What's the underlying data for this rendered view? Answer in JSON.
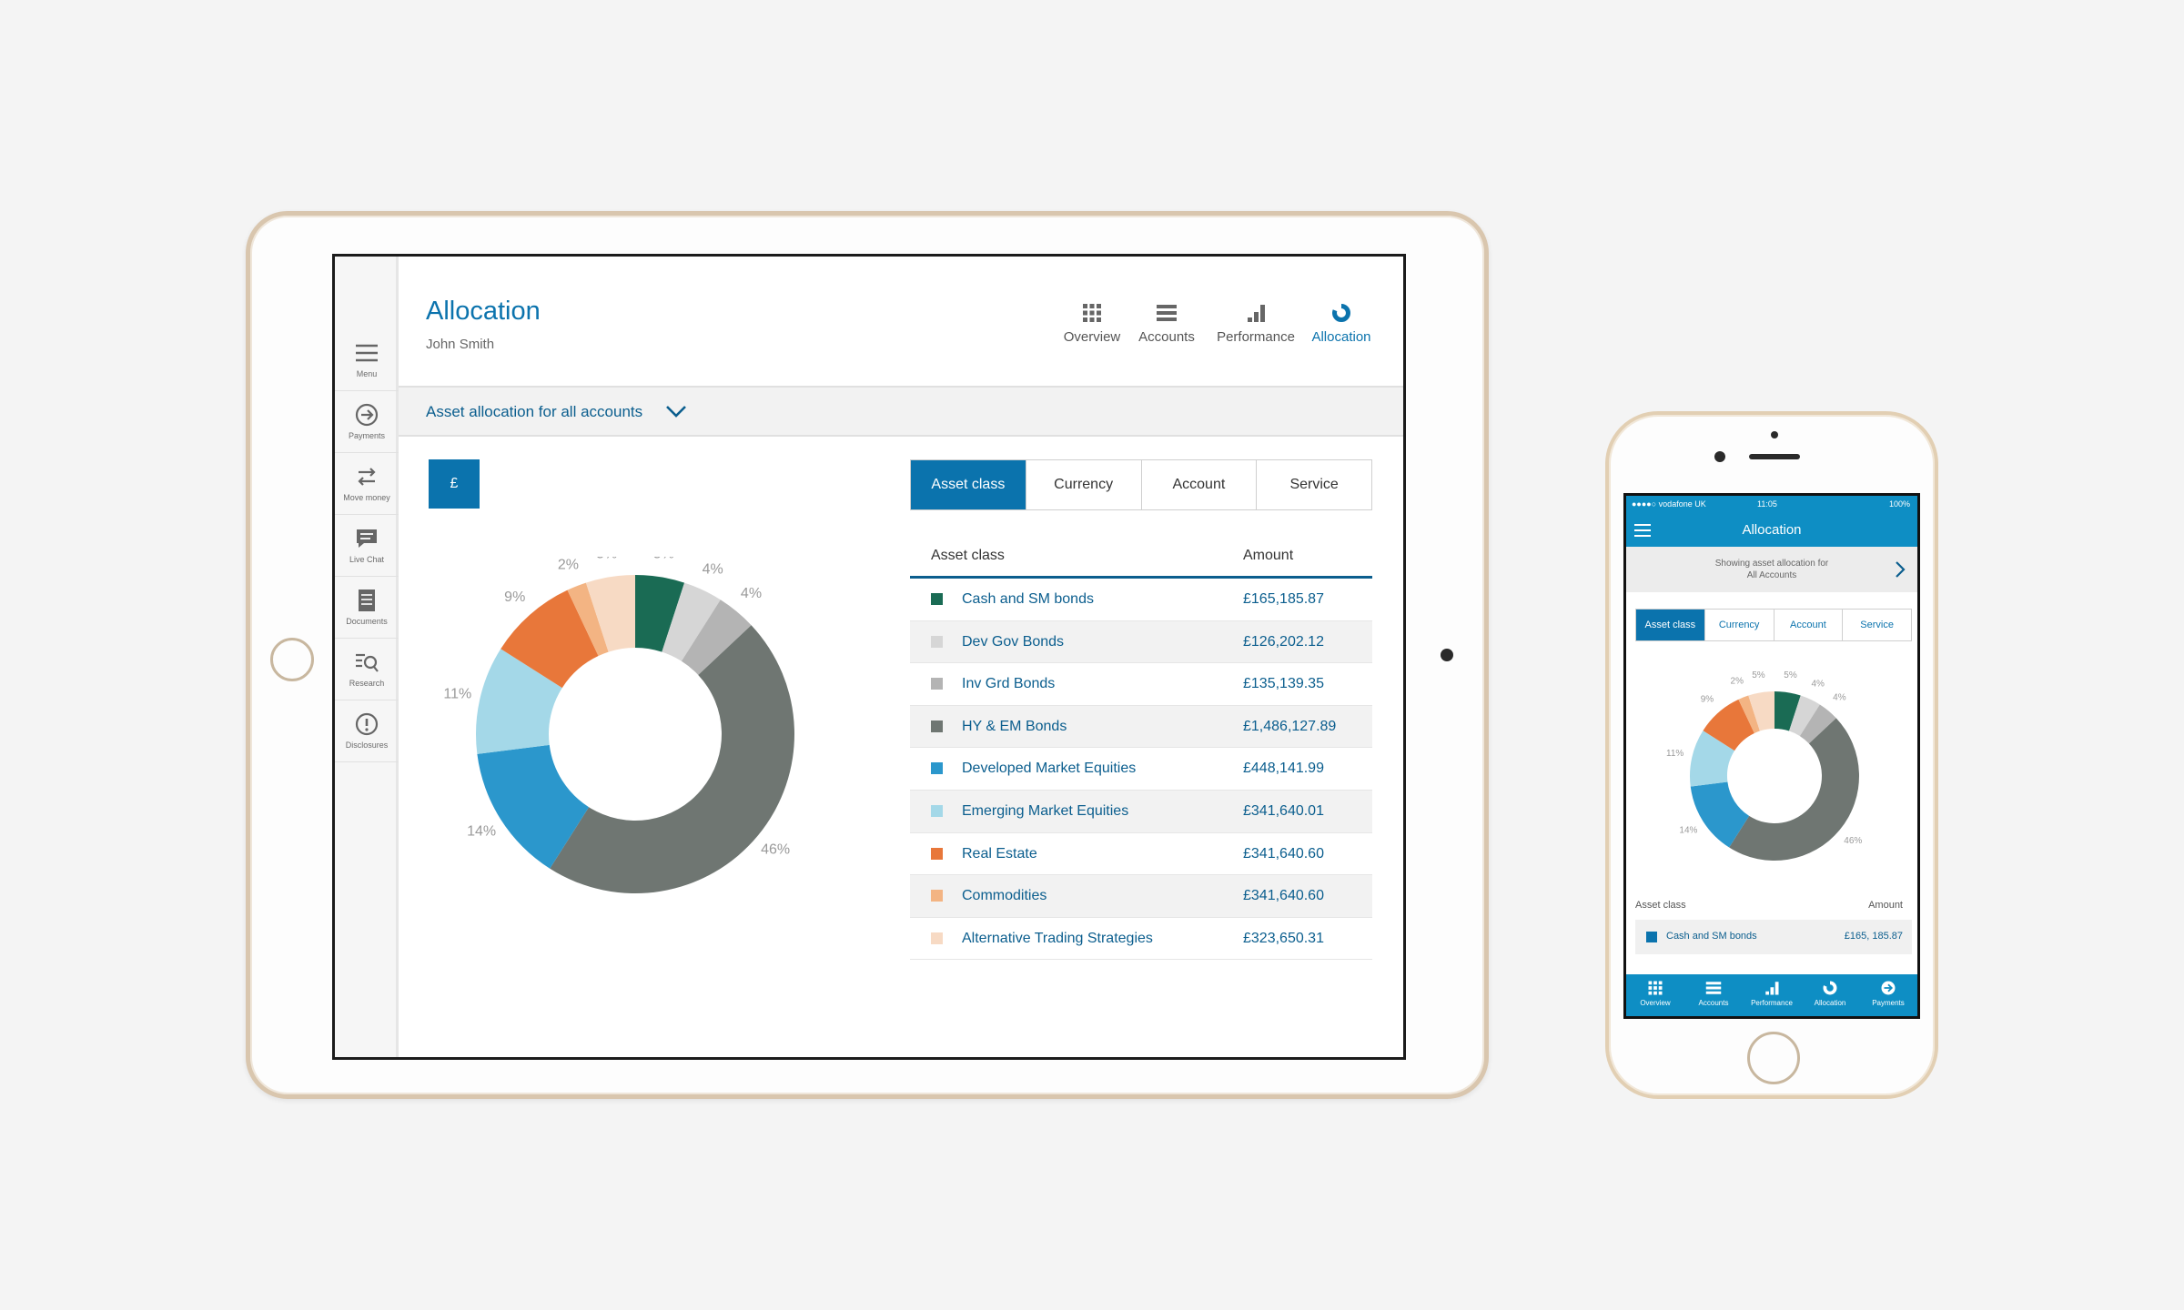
{
  "tablet": {
    "sidebar": [
      {
        "icon": "hamburger-menu-icon",
        "label": "Menu"
      },
      {
        "icon": "arrow-circle-icon",
        "label": "Payments"
      },
      {
        "icon": "swap-arrows-icon",
        "label": "Move money"
      },
      {
        "icon": "chat-bubble-icon",
        "label": "Live Chat"
      },
      {
        "icon": "document-icon",
        "label": "Documents"
      },
      {
        "icon": "search-list-icon",
        "label": "Research"
      },
      {
        "icon": "info-circle-icon",
        "label": "Disclosures"
      }
    ],
    "title": "Allocation",
    "user": "John Smith",
    "nav": [
      {
        "icon": "grid-icon",
        "label": "Overview"
      },
      {
        "icon": "list-icon",
        "label": "Accounts"
      },
      {
        "icon": "bar-chart-icon",
        "label": "Performance"
      },
      {
        "icon": "donut-icon",
        "label": "Allocation"
      }
    ],
    "active_nav": "Allocation",
    "filter_label": "Asset allocation for all accounts",
    "currency_button": "£",
    "tabs": [
      "Asset class",
      "Currency",
      "Account",
      "Service"
    ],
    "active_tab": "Asset class",
    "table": {
      "headers": [
        "Asset class",
        "Amount"
      ],
      "rows": [
        {
          "name": "Cash and SM bonds",
          "amount": "£165,185.87"
        },
        {
          "name": "Dev Gov Bonds",
          "amount": "£126,202.12"
        },
        {
          "name": "Inv Grd Bonds",
          "amount": "£135,139.35"
        },
        {
          "name": "HY & EM Bonds",
          "amount": "£1,486,127.89"
        },
        {
          "name": "Developed Market Equities",
          "amount": "£448,141.99"
        },
        {
          "name": "Emerging Market Equities",
          "amount": "£341,640.01"
        },
        {
          "name": "Real Estate",
          "amount": "£341,640.60"
        },
        {
          "name": "Commodities",
          "amount": "£341,640.60"
        },
        {
          "name": "Alternative Trading Strategies",
          "amount": "£323,650.31"
        }
      ]
    }
  },
  "phone": {
    "status": {
      "carrier": "●●●●○ vodafone UK",
      "time": "11:05",
      "battery": "100%"
    },
    "title": "Allocation",
    "showing_line1": "Showing asset allocation for",
    "showing_line2": "All Accounts",
    "tabs": [
      "Asset class",
      "Currency",
      "Account",
      "Service"
    ],
    "active_tab": "Asset class",
    "table_headers": [
      "Asset class",
      "Amount"
    ],
    "row": {
      "name": "Cash and SM bonds",
      "amount": "£165, 185.87"
    },
    "nav": [
      {
        "icon": "grid-icon",
        "label": "Overview"
      },
      {
        "icon": "list-icon",
        "label": "Accounts"
      },
      {
        "icon": "bar-chart-icon",
        "label": "Performance"
      },
      {
        "icon": "donut-icon",
        "label": "Allocation"
      },
      {
        "icon": "arrow-circle-icon",
        "label": "Payments"
      }
    ]
  },
  "colors": {
    "brand": "#0b73ad",
    "cash_sm_bonds": "#1a6b54",
    "dev_gov_bonds": "#d6d6d6",
    "inv_grd_bonds": "#b4b4b4",
    "hy_em_bonds": "#6f7672",
    "developed_equities": "#2b97cc",
    "emerging_equities": "#a4d8e8",
    "real_estate": "#e8773a",
    "commodities": "#f3b483",
    "alternative": "#f7dac4"
  },
  "chart_data": {
    "type": "pie",
    "variant": "donut",
    "slices": [
      {
        "name": "Cash and SM bonds",
        "value": 5,
        "label": "5%",
        "color": "#1a6b54"
      },
      {
        "name": "Dev Gov Bonds",
        "value": 4,
        "label": "4%",
        "color": "#d6d6d6"
      },
      {
        "name": "Inv Grd Bonds",
        "value": 4,
        "label": "4%",
        "color": "#b4b4b4"
      },
      {
        "name": "HY & EM Bonds",
        "value": 46,
        "label": "46%",
        "color": "#6f7672"
      },
      {
        "name": "Developed Market Equities",
        "value": 14,
        "label": "14%",
        "color": "#2b97cc"
      },
      {
        "name": "Emerging Market Equities",
        "value": 11,
        "label": "11%",
        "color": "#a4d8e8"
      },
      {
        "name": "Real Estate",
        "value": 9,
        "label": "9%",
        "color": "#e8773a"
      },
      {
        "name": "Commodities",
        "value": 2,
        "label": "2%",
        "color": "#f3b483"
      },
      {
        "name": "Alternative Trading Strategies",
        "value": 5,
        "label": "5%",
        "color": "#f7dac4"
      }
    ]
  }
}
